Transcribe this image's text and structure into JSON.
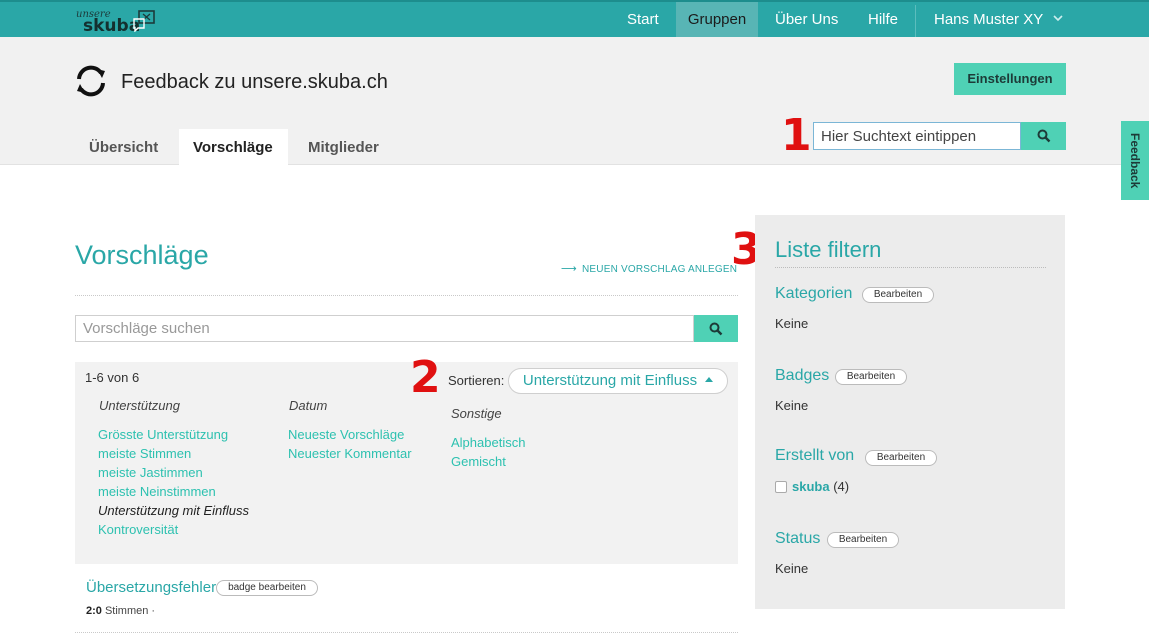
{
  "nav": {
    "logo_small": "unsere",
    "logo_big": "skuba",
    "items": [
      {
        "label": "Start"
      },
      {
        "label": "Gruppen"
      },
      {
        "label": "Über Uns"
      },
      {
        "label": "Hilfe"
      }
    ],
    "user": "Hans Muster XY"
  },
  "header": {
    "title": "Feedback zu unsere.skuba.ch",
    "settings_label": "Einstellungen",
    "tabs": [
      {
        "label": "Übersicht"
      },
      {
        "label": "Vorschläge"
      },
      {
        "label": "Mitglieder"
      }
    ],
    "search_value": "Hier Suchtext eintippen"
  },
  "annotations": {
    "one": "1",
    "two": "2",
    "three": "3"
  },
  "feedback_tab": "Feedback",
  "main": {
    "title": "Vorschläge",
    "new_proposal": "NEUEN VORSCHLAG ANLEGEN",
    "search_placeholder": "Vorschläge suchen",
    "count": "1-6 von 6",
    "sort_label": "Sortieren:",
    "sort_selected": "Unterstützung mit Einfluss",
    "sort_columns": [
      {
        "heading": "Unterstützung",
        "options": [
          "Grösste Unterstützung",
          "meiste Stimmen",
          "meiste Jastimmen",
          "meiste Neinstimmen",
          "Unterstützung mit Einfluss",
          "Kontroversität"
        ]
      },
      {
        "heading": "Datum",
        "options": [
          "Neueste Vorschläge",
          "Neuester Kommentar"
        ]
      },
      {
        "heading": "Sonstige",
        "options": [
          "Alphabetisch",
          "Gemischt"
        ]
      }
    ],
    "result": {
      "title": "Übersetzungsfehler",
      "badge_label": "badge bearbeiten",
      "votes": "2:0",
      "votes_label": "Stimmen ·"
    }
  },
  "sidebar": {
    "title": "Liste filtern",
    "edit_label": "Bearbeiten",
    "sections": [
      {
        "heading": "Kategorien",
        "value": "Keine"
      },
      {
        "heading": "Badges",
        "value": "Keine"
      },
      {
        "heading": "Erstellt von",
        "user": "skuba",
        "user_count": "(4)"
      },
      {
        "heading": "Status",
        "value": "Keine"
      }
    ]
  },
  "colors": {
    "accent": "#2aa7a7",
    "button": "#4fd1b5",
    "annotation": "#e01010"
  }
}
